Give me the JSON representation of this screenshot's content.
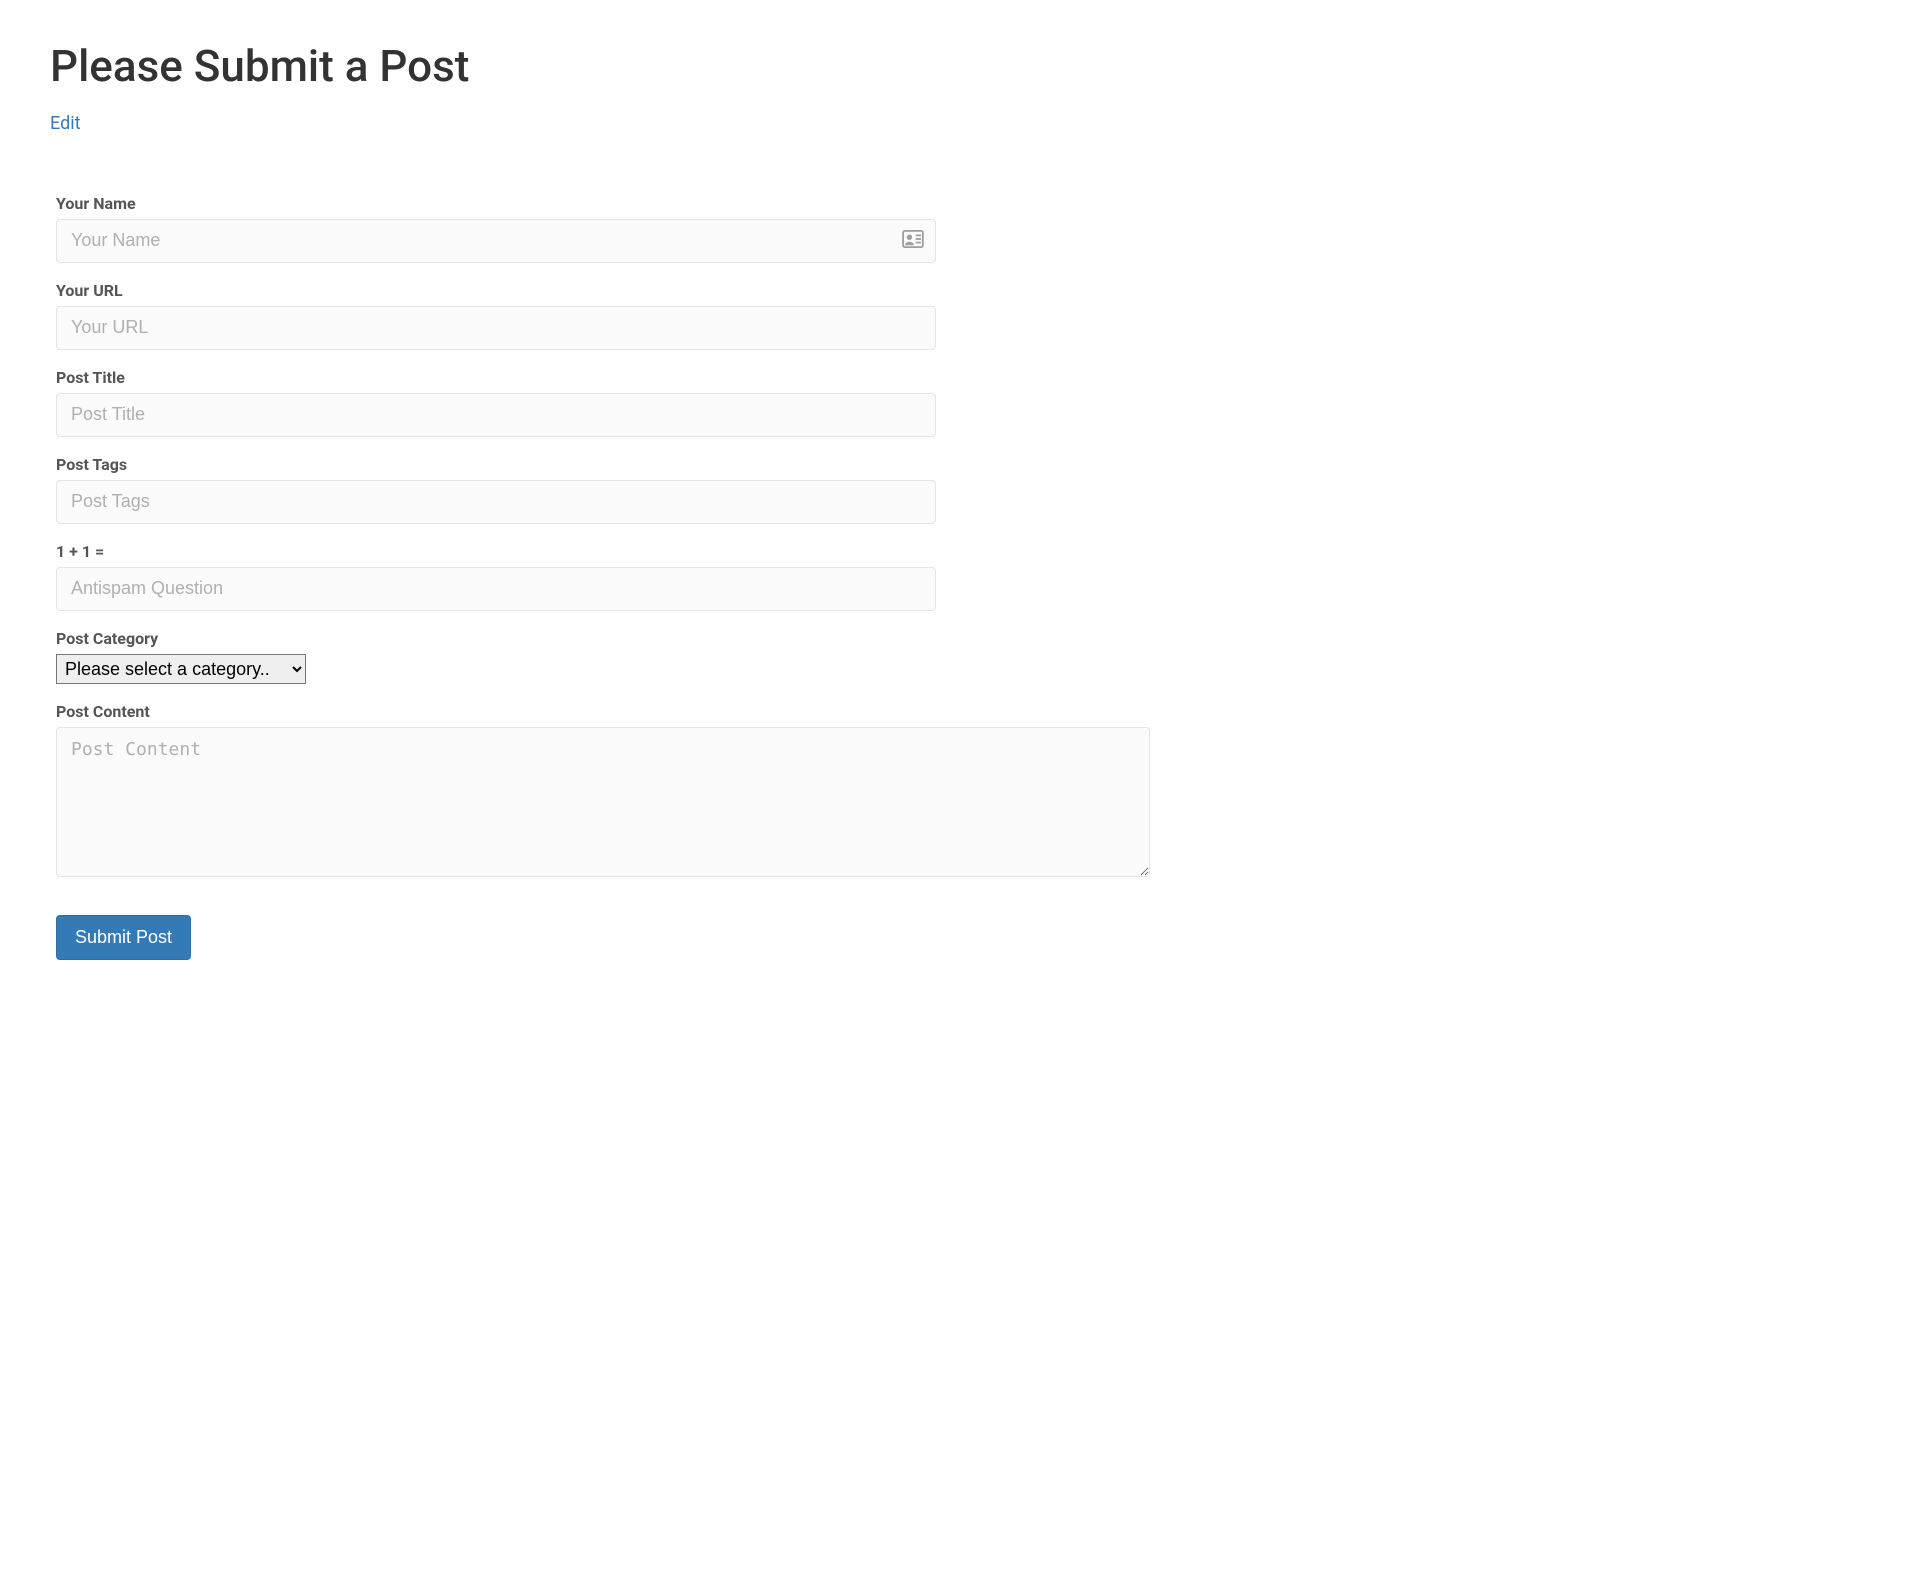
{
  "page": {
    "title": "Please Submit a Post",
    "edit_label": "Edit"
  },
  "form": {
    "name": {
      "label": "Your Name",
      "placeholder": "Your Name",
      "value": ""
    },
    "url": {
      "label": "Your URL",
      "placeholder": "Your URL",
      "value": ""
    },
    "post_title": {
      "label": "Post Title",
      "placeholder": "Post Title",
      "value": ""
    },
    "post_tags": {
      "label": "Post Tags",
      "placeholder": "Post Tags",
      "value": ""
    },
    "antispam": {
      "label": "1 + 1 =",
      "placeholder": "Antispam Question",
      "value": ""
    },
    "category": {
      "label": "Post Category",
      "selected": "Please select a category.."
    },
    "content": {
      "label": "Post Content",
      "placeholder": "Post Content",
      "value": ""
    },
    "submit_label": "Submit Post"
  },
  "icons": {
    "contact_card": "contact-card-icon"
  }
}
